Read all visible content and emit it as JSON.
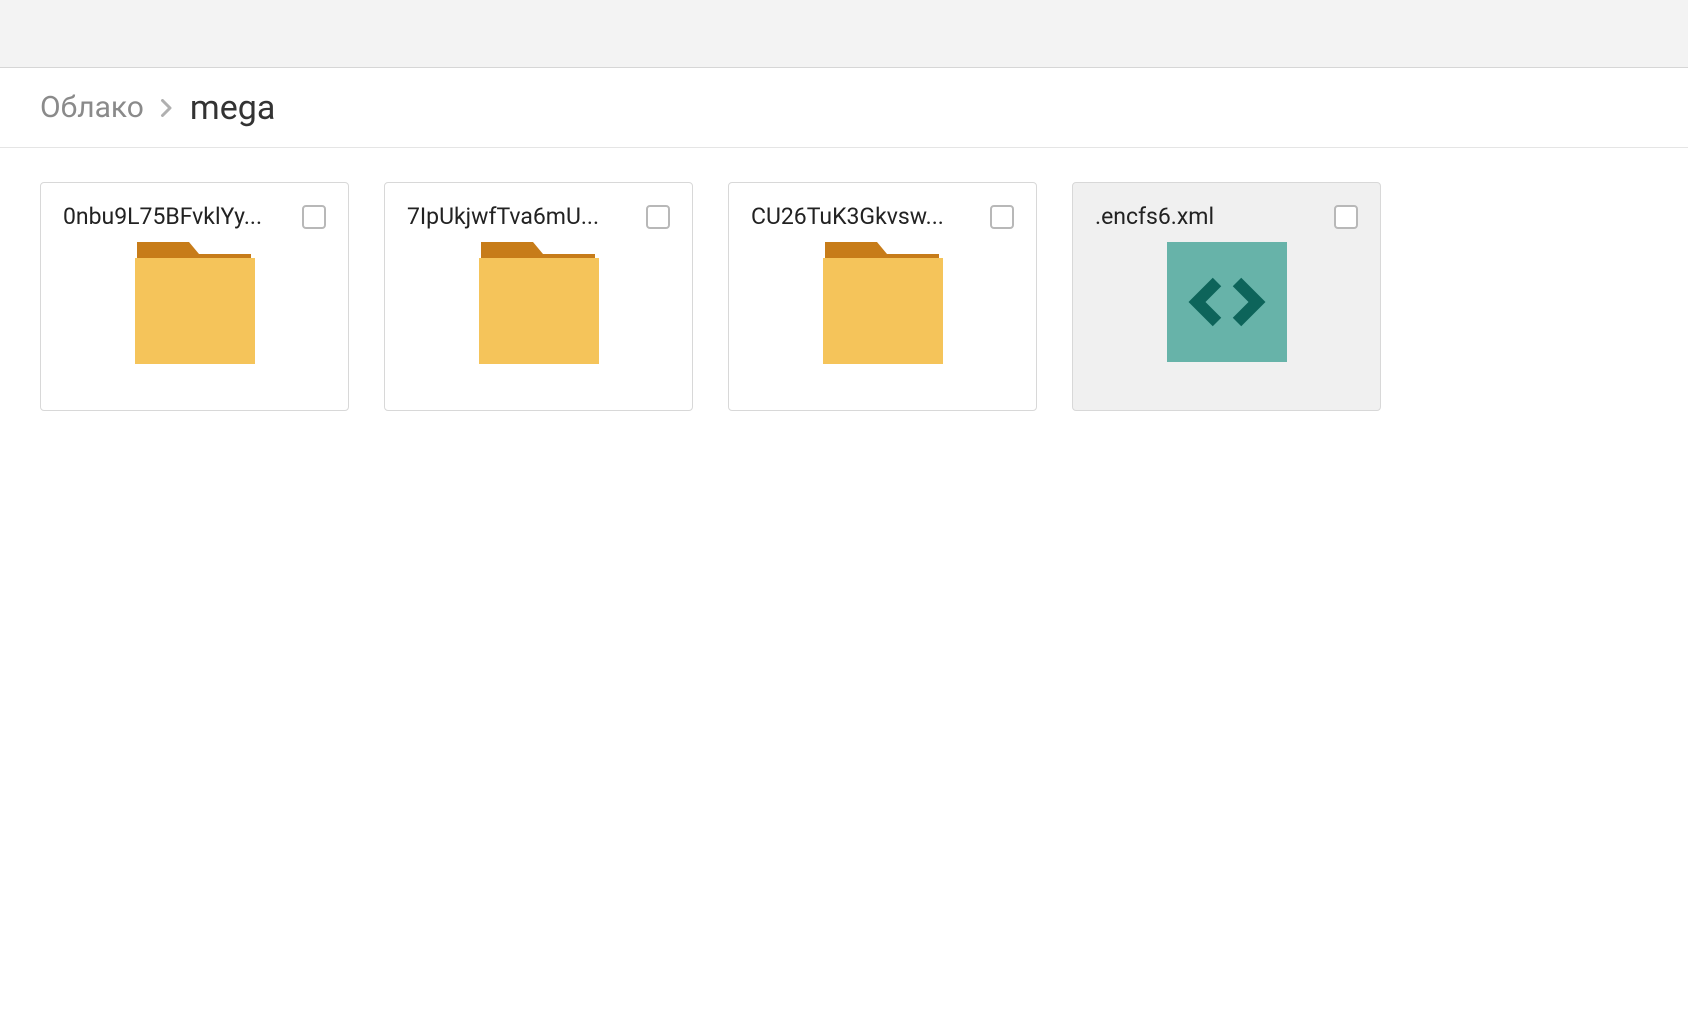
{
  "breadcrumb": {
    "root": "Облако",
    "current": "mega"
  },
  "items": [
    {
      "name": "0nbu9L75BFvklYy...",
      "type": "folder",
      "selected": false
    },
    {
      "name": "7IpUkjwfTva6mU...",
      "type": "folder",
      "selected": false
    },
    {
      "name": "CU26TuK3Gkvsw...",
      "type": "folder",
      "selected": false
    },
    {
      "name": ".encfs6.xml",
      "type": "code-file",
      "selected": true
    }
  ],
  "colors": {
    "folder_tab": "#c77c19",
    "folder_body": "#f5c45a",
    "code_bg": "#67b3a9",
    "code_chevron": "#0d645a"
  }
}
